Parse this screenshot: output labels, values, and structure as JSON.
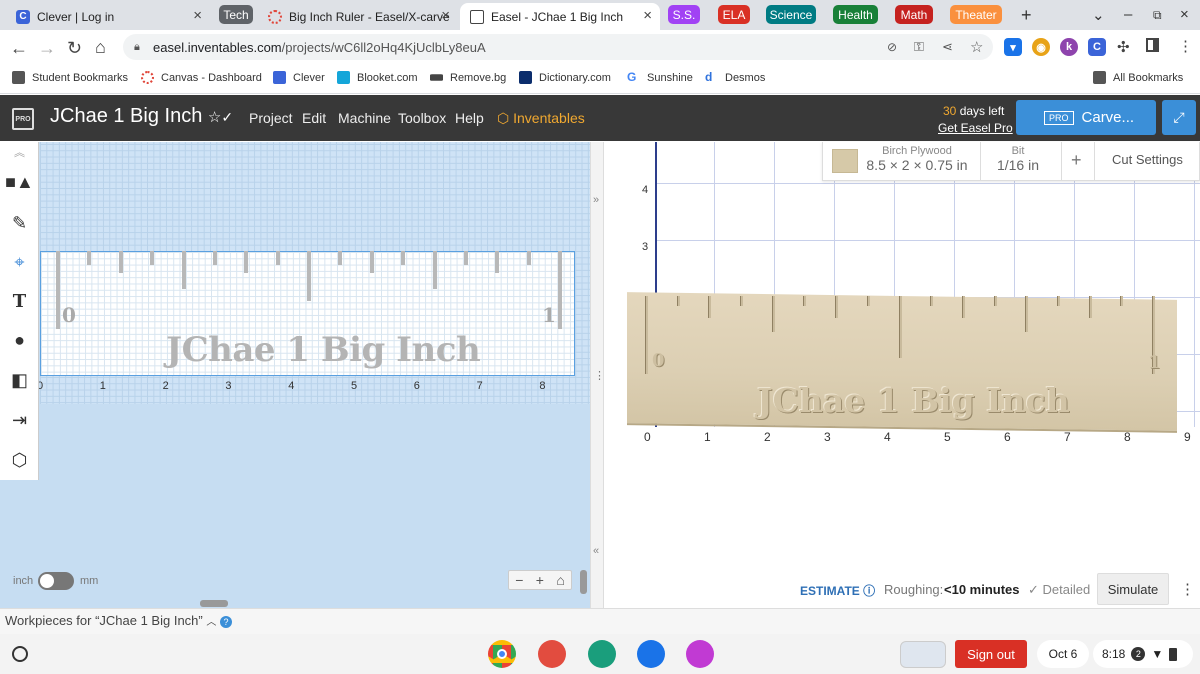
{
  "browser": {
    "tabs": [
      {
        "title": "Clever | Log in",
        "icon": "clever-icon",
        "color": "#3b64d8"
      },
      {
        "title": "Big Inch Ruler - Easel/X-carve",
        "icon": "canvas-icon",
        "color": "#e0463a"
      },
      {
        "title": "Easel - JChae 1 Big Inch",
        "icon": "easel-icon",
        "color": "#444444"
      }
    ],
    "tab_groups": [
      {
        "label": "Tech",
        "color": "#5f6368"
      },
      {
        "label": "S.S.",
        "color": "#a142f4"
      },
      {
        "label": "ELA",
        "color": "#d93025"
      },
      {
        "label": "Science",
        "color": "#007b83"
      },
      {
        "label": "Health",
        "color": "#188038"
      },
      {
        "label": "Math",
        "color": "#c5221f"
      },
      {
        "label": "Theater",
        "color": "#fa903e"
      }
    ],
    "url_domain": "easel.inventables.com",
    "url_path": "/projects/wC6ll2oHq4KjUclbLy8euA",
    "bookmarks": [
      {
        "label": "Student Bookmarks",
        "icon": "folder-icon"
      },
      {
        "label": "Canvas - Dashboard",
        "icon": "canvas-icon"
      },
      {
        "label": "Clever",
        "icon": "clever-icon"
      },
      {
        "label": "Blooket.com",
        "icon": "blooket-icon"
      },
      {
        "label": "Remove.bg",
        "icon": "removebg-icon"
      },
      {
        "label": "Dictionary.com",
        "icon": "dictionary-icon"
      },
      {
        "label": "Sunshine",
        "icon": "google-icon"
      },
      {
        "label": "Desmos",
        "icon": "desmos-icon"
      }
    ],
    "all_bookmarks": "All Bookmarks"
  },
  "app": {
    "project_title": "JChae 1 Big Inch",
    "menu": [
      "Project",
      "Edit",
      "Machine",
      "Toolbox",
      "Help"
    ],
    "brand": "Inventables",
    "trial_days": "30",
    "trial_text": "days left",
    "get_pro": "Get Easel Pro",
    "pro_badge": "PRO",
    "carve_label": "Carve...",
    "material_name": "Birch Plywood",
    "material_size": "8.5 × 2 × 0.75 in",
    "bit_label": "Bit",
    "bit_value": "1/16 in",
    "cut_settings": "Cut Settings",
    "ruler_text": "JChae 1 Big Inch",
    "ruler_zero": "0",
    "ruler_one": "1",
    "axis_2d_x": [
      "0",
      "1",
      "2",
      "3",
      "4",
      "5",
      "6",
      "7",
      "8"
    ],
    "axis_3d_x": [
      "0",
      "1",
      "2",
      "3",
      "4",
      "5",
      "6",
      "7",
      "8",
      "9"
    ],
    "axis_3d_y": [
      "4",
      "3"
    ],
    "unit_inch": "inch",
    "unit_mm": "mm",
    "estimate": "ESTIMATE",
    "roughing_label": "Roughing:",
    "roughing_value": "<10 minutes",
    "detailed": "Detailed",
    "simulate": "Simulate",
    "workpieces": "Workpieces for “JChae 1 Big Inch”"
  },
  "shelf": {
    "sign_out": "Sign out",
    "date": "Oct 6",
    "time": "8:18",
    "notifications": "2"
  }
}
